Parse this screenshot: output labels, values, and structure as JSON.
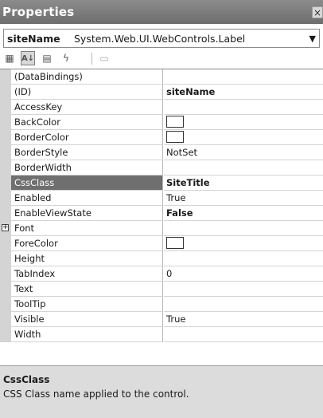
{
  "window": {
    "title": "Properties",
    "close_glyph": "×"
  },
  "object_selector": {
    "name": "siteName",
    "type": "System.Web.UI.WebControls.Label",
    "dropdown_icon": "dropdown-arrow-icon"
  },
  "toolbar": {
    "buttons": [
      {
        "icon": "categorized-icon",
        "glyph": "▦",
        "active": false
      },
      {
        "icon": "alphabetical-icon",
        "glyph": "A↓",
        "active": true
      },
      {
        "icon": "properties-icon",
        "glyph": "▤",
        "active": false
      },
      {
        "icon": "events-icon",
        "glyph": "ϟ",
        "active": false
      },
      {
        "icon": "property-pages-icon",
        "glyph": "▭",
        "active": false
      }
    ]
  },
  "properties": [
    {
      "name": "(DataBindings)",
      "value": ""
    },
    {
      "name": "(ID)",
      "value": "siteName",
      "bold": true
    },
    {
      "name": "AccessKey",
      "value": ""
    },
    {
      "name": "BackColor",
      "value": "",
      "swatch": true
    },
    {
      "name": "BorderColor",
      "value": "",
      "swatch": true
    },
    {
      "name": "BorderStyle",
      "value": "NotSet"
    },
    {
      "name": "BorderWidth",
      "value": ""
    },
    {
      "name": "CssClass",
      "value": "SiteTitle",
      "bold": true,
      "selected": true
    },
    {
      "name": "Enabled",
      "value": "True"
    },
    {
      "name": "EnableViewState",
      "value": "False",
      "bold": true
    },
    {
      "name": "Font",
      "value": "",
      "expandable": true
    },
    {
      "name": "ForeColor",
      "value": "",
      "swatch": true
    },
    {
      "name": "Height",
      "value": ""
    },
    {
      "name": "TabIndex",
      "value": "0"
    },
    {
      "name": "Text",
      "value": ""
    },
    {
      "name": "ToolTip",
      "value": ""
    },
    {
      "name": "Visible",
      "value": "True"
    },
    {
      "name": "Width",
      "value": ""
    }
  ],
  "description": {
    "title": "CssClass",
    "text": "CSS Class name applied to the control."
  },
  "colors": {
    "title_bar": "#7d7d7d",
    "selected_row": "#6f6f6f",
    "margin": "#d4d4d4",
    "description_bg": "#dcdcdc"
  }
}
